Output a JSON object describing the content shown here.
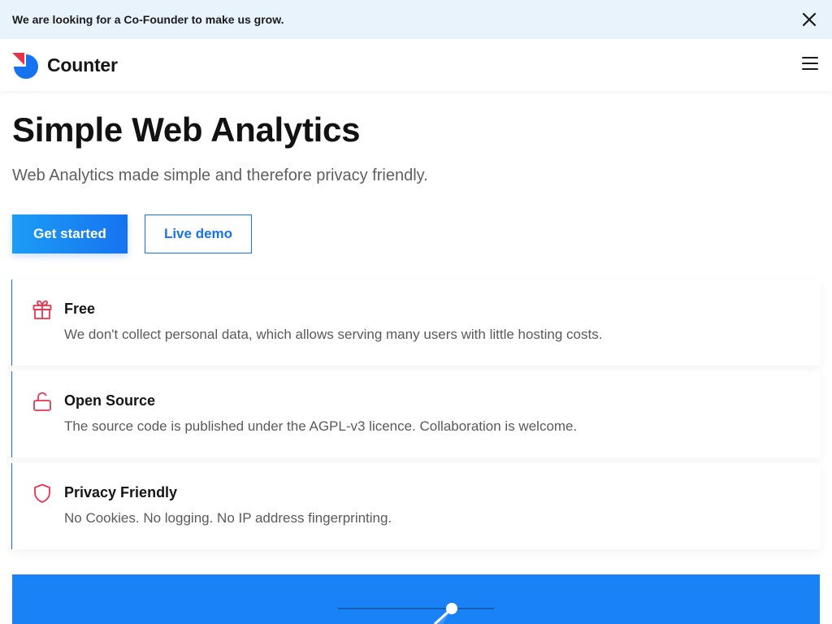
{
  "banner": {
    "text": "We are looking for a Co-Founder to make us grow."
  },
  "header": {
    "logo_text": "Counter"
  },
  "hero": {
    "title": "Simple Web Analytics",
    "subtitle": "Web Analytics made simple and therefore privacy friendly.",
    "primary_button": "Get started",
    "secondary_button": "Live demo"
  },
  "features": [
    {
      "icon": "gift-icon",
      "title": "Free",
      "description": "We don't collect personal data, which allows serving many users with little hosting costs."
    },
    {
      "icon": "unlock-icon",
      "title": "Open Source",
      "description": "The source code is published under the AGPL-v3 licence. Collaboration is welcome."
    },
    {
      "icon": "shield-icon",
      "title": "Privacy Friendly",
      "description": "No Cookies. No logging. No IP address fingerprinting."
    }
  ],
  "colors": {
    "accent": "#1673f0",
    "icon_accent": "#e8334f",
    "banner_bg": "#e8f3fc",
    "section_bg": "#1a82f7"
  }
}
